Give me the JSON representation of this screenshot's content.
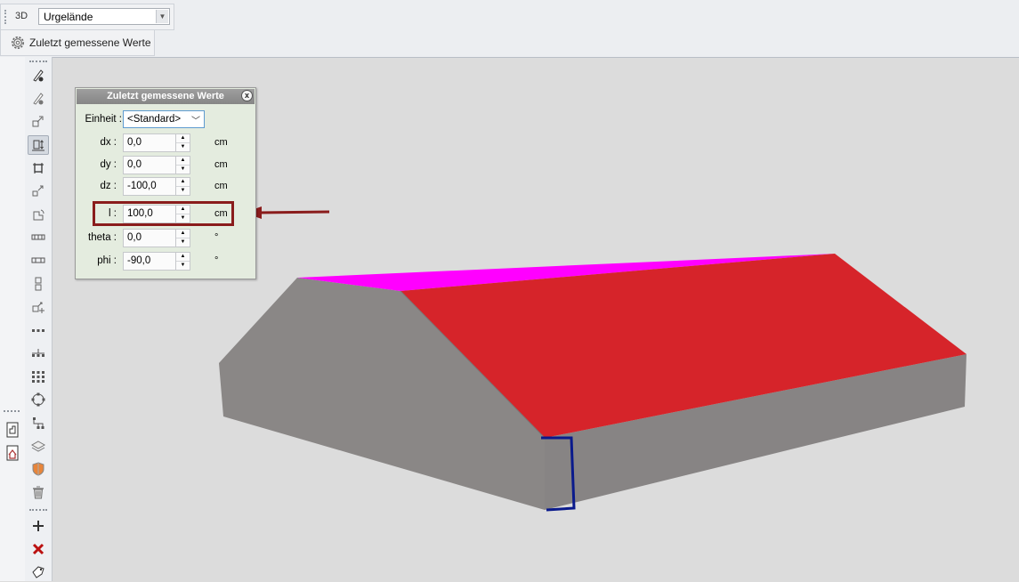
{
  "toolbar": {
    "view_label": "3D",
    "terrain_value": "Urgelände",
    "measured_button_label": "Zuletzt gemessene Werte"
  },
  "dialog": {
    "title": "Zuletzt gemessene Werte",
    "close_label": "x",
    "unit_label": "Einheit :",
    "unit_value": "<Standard>",
    "fields": [
      {
        "label": "dx :",
        "value": "0,0",
        "unit": "cm"
      },
      {
        "label": "dy :",
        "value": "0,0",
        "unit": "cm"
      },
      {
        "label": "dz :",
        "value": "-100,0",
        "unit": "cm"
      },
      {
        "label": "l :",
        "value": "100,0",
        "unit": "cm"
      },
      {
        "label": "theta :",
        "value": "0,0",
        "unit": "°"
      },
      {
        "label": "phi :",
        "value": "-90,0",
        "unit": "°"
      }
    ]
  },
  "colors": {
    "roof_front": "#d6242a",
    "roof_back": "#ff00ff",
    "wall": "#8a8786",
    "wall_dark": "#7e7b7a",
    "annotation": "#8a1c1c",
    "measure_line": "#0a1a8c"
  },
  "icons": {
    "sidebar": [
      "pen-point-icon",
      "pen-edit-icon",
      "copy-transform-icon",
      "height-measure-icon",
      "crop-transform-icon",
      "move-copy-icon",
      "rotate-copy-icon",
      "mirror-icon",
      "mirror-copy-icon",
      "stack-icon",
      "add-copy-icon",
      "align-dots-icon",
      "distribute-icon",
      "grid-icon",
      "circle-select-icon",
      "hierarchy-icon",
      "layer-icon",
      "shield-icon",
      "trash-icon",
      "plus-icon",
      "delete-x-icon",
      "tag-icon"
    ],
    "left": [
      "floor-plan-icon",
      "house-icon"
    ]
  }
}
